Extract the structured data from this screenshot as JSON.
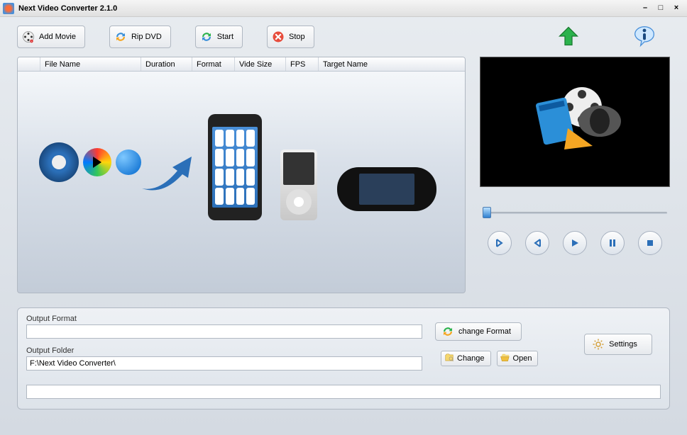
{
  "window": {
    "title": "Next Video Converter 2.1.0"
  },
  "toolbar": {
    "add_movie": "Add Movie",
    "rip_dvd": "Rip DVD",
    "start": "Start",
    "stop": "Stop"
  },
  "columns": {
    "c0": "",
    "c1": "File Name",
    "c2": "Duration",
    "c3": "Format",
    "c4": "Vide Size",
    "c5": "FPS",
    "c6": "Target Name"
  },
  "output": {
    "format_label": "Output Format",
    "format_value": "",
    "folder_label": "Output Folder",
    "folder_value": "F:\\Next Video Converter\\",
    "change_format": "change Format",
    "change": "Change",
    "open": "Open"
  },
  "settings_label": "Settings"
}
